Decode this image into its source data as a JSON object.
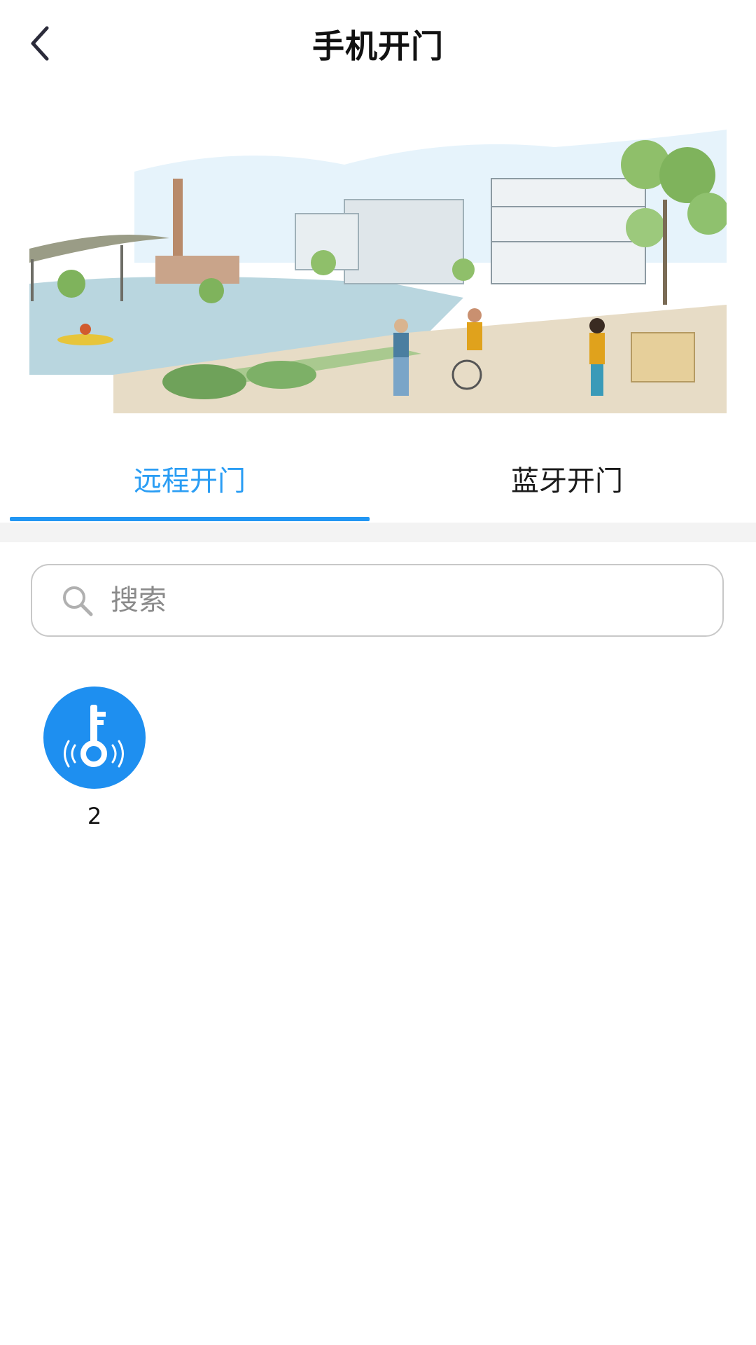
{
  "header": {
    "title": "手机开门",
    "back_icon": "chevron-left-icon"
  },
  "banner": {
    "image": "city-waterfront-illustration",
    "active_dot_color": "#b36f12"
  },
  "tabs": [
    {
      "label": "远程开门",
      "active": true
    },
    {
      "label": "蓝牙开门",
      "active": false
    }
  ],
  "colors": {
    "accent": "#2196f3",
    "active_tab_text": "#2a9df4",
    "door_icon_bg": "#1e8ff0"
  },
  "search": {
    "placeholder": "搜索",
    "value": "",
    "icon": "search-icon"
  },
  "doors": [
    {
      "label": "2",
      "icon": "key-signal-icon"
    }
  ]
}
